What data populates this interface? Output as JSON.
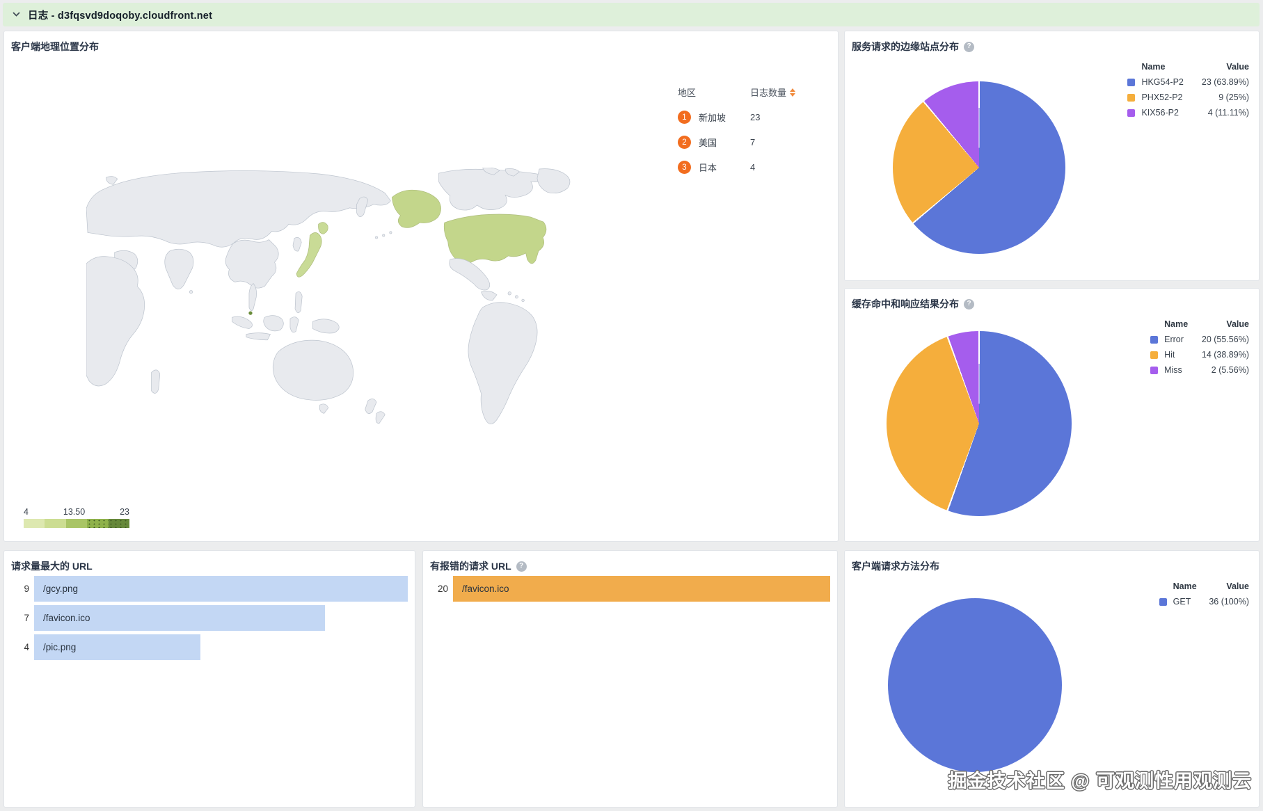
{
  "header": {
    "title": "日志 - d3fqsvd9doqoby.cloudfront.net"
  },
  "watermark": "掘金技术社区 @ 可观测性用观测云",
  "colors": {
    "header_bg": "#def0da",
    "page_bg": "#ecedee",
    "pie_blue": "#5b76d8",
    "pie_orange": "#f5ae3c",
    "pie_purple": "#a55ded",
    "bar_blue": "#c3d7f4",
    "bar_orange": "#f1ac4c",
    "rank_badge": "#f26d1f",
    "map_land": "#e8eaee",
    "map_highlight_us": "#c3d68b",
    "map_highlight_jp": "#c9db96",
    "map_highlight_sg": "#6a8c3a"
  },
  "map_panel": {
    "title": "客户端地理位置分布",
    "table": {
      "region_header": "地区",
      "count_header": "日志数量",
      "rows": [
        {
          "rank": "1",
          "region": "新加坡",
          "count": "23"
        },
        {
          "rank": "2",
          "region": "美国",
          "count": "7"
        },
        {
          "rank": "3",
          "region": "日本",
          "count": "4"
        }
      ]
    },
    "scale_labels": [
      "4",
      "13.50",
      "23"
    ],
    "scale_colors": [
      "#dde8b0",
      "#ccdd92",
      "#a9c566",
      "#8fb24b",
      "#66883a"
    ]
  },
  "pie_panels": [
    {
      "title": "服务请求的边缘站点分布",
      "has_help": true,
      "legend_headers": [
        "Name",
        "Value"
      ]
    },
    {
      "title": "缓存命中和响应结果分布",
      "has_help": true,
      "legend_headers": [
        "Name",
        "Value"
      ]
    },
    {
      "title": "客户端请求方法分布",
      "has_help": false,
      "legend_headers": [
        "Name",
        "Value"
      ]
    }
  ],
  "bar_panels": [
    {
      "title": "请求量最大的 URL",
      "has_help": false
    },
    {
      "title": "有报错的请求 URL",
      "has_help": true
    }
  ],
  "chart_data": [
    {
      "type": "heatmap",
      "subtype": "choropleth_world_map",
      "title": "客户端地理位置分布",
      "metric": "日志数量",
      "regions": [
        {
          "name": "新加坡",
          "value": 23
        },
        {
          "name": "美国",
          "value": 7
        },
        {
          "name": "日本",
          "value": 4
        }
      ],
      "scale": {
        "min": 4,
        "mid": 13.5,
        "max": 23,
        "labels": [
          "4",
          "13.50",
          "23"
        ]
      },
      "legend_position": "right"
    },
    {
      "type": "pie",
      "title": "服务请求的边缘站点分布",
      "legend_position": "right",
      "slices": [
        {
          "name": "HKG54-P2",
          "value": 23,
          "pct": 63.89,
          "label": "23 (63.89%)",
          "color": "#5b76d8"
        },
        {
          "name": "PHX52-P2",
          "value": 9,
          "pct": 25,
          "label": "9 (25%)",
          "color": "#f5ae3c"
        },
        {
          "name": "KIX56-P2",
          "value": 4,
          "pct": 11.11,
          "label": "4 (11.11%)",
          "color": "#a55ded"
        }
      ]
    },
    {
      "type": "pie",
      "title": "缓存命中和响应结果分布",
      "legend_position": "right",
      "slices": [
        {
          "name": "Error",
          "value": 20,
          "pct": 55.56,
          "label": "20 (55.56%)",
          "color": "#5b76d8"
        },
        {
          "name": "Hit",
          "value": 14,
          "pct": 38.89,
          "label": "14 (38.89%)",
          "color": "#f5ae3c"
        },
        {
          "name": "Miss",
          "value": 2,
          "pct": 5.56,
          "label": "2 (5.56%)",
          "color": "#a55ded"
        }
      ]
    },
    {
      "type": "bar",
      "title": "请求量最大的 URL",
      "orientation": "horizontal",
      "categories": [
        "/gcy.png",
        "/favicon.ico",
        "/pic.png"
      ],
      "values": [
        9,
        7,
        4
      ],
      "xlim": [
        0,
        9
      ],
      "color": "#c3d7f4"
    },
    {
      "type": "bar",
      "title": "有报错的请求 URL",
      "orientation": "horizontal",
      "categories": [
        "/favicon.ico"
      ],
      "values": [
        20
      ],
      "xlim": [
        0,
        20
      ],
      "color": "#f1ac4c"
    },
    {
      "type": "pie",
      "title": "客户端请求方法分布",
      "legend_position": "right",
      "slices": [
        {
          "name": "GET",
          "value": 36,
          "pct": 100,
          "label": "36 (100%)",
          "color": "#5b76d8"
        }
      ]
    }
  ]
}
